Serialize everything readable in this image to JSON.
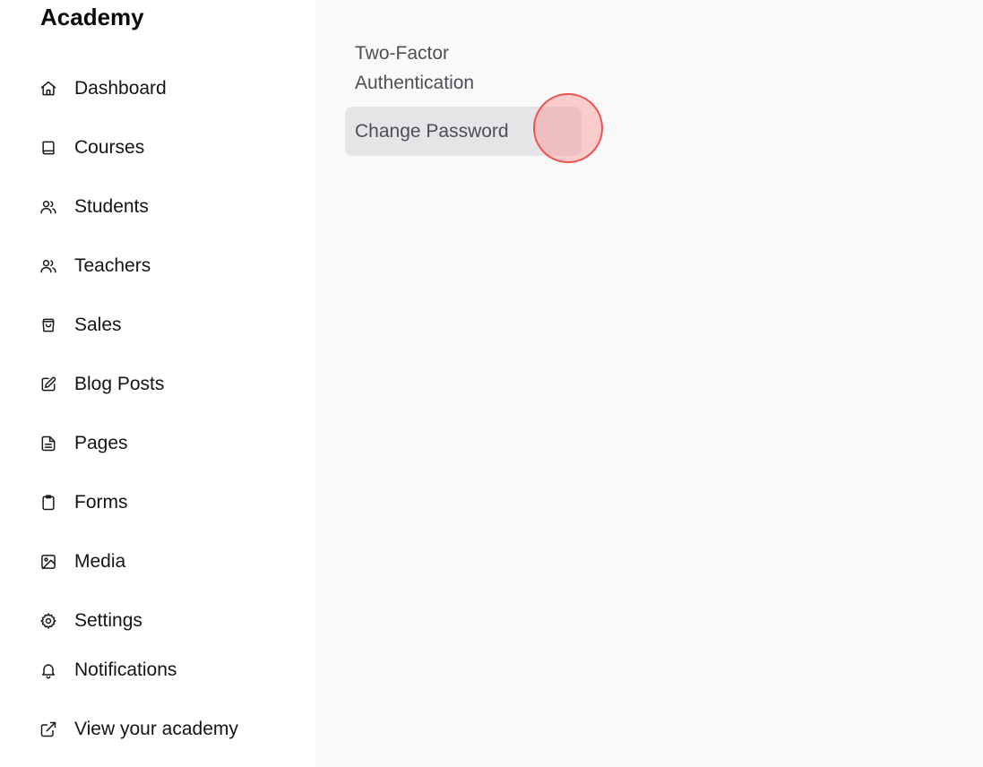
{
  "sidebar": {
    "brand": "Academy",
    "items": [
      {
        "label": "Dashboard",
        "icon": "home-icon"
      },
      {
        "label": "Courses",
        "icon": "book-icon"
      },
      {
        "label": "Students",
        "icon": "users-icon"
      },
      {
        "label": "Teachers",
        "icon": "users-icon"
      },
      {
        "label": "Sales",
        "icon": "shopping-bag-icon"
      },
      {
        "label": "Blog Posts",
        "icon": "edit-icon"
      },
      {
        "label": "Pages",
        "icon": "file-text-icon"
      },
      {
        "label": "Forms",
        "icon": "clipboard-icon"
      },
      {
        "label": "Media",
        "icon": "image-icon"
      },
      {
        "label": "Settings",
        "icon": "gear-icon"
      },
      {
        "label": "Notifications",
        "icon": "bell-icon"
      },
      {
        "label": "View your academy",
        "icon": "external-link-icon"
      }
    ]
  },
  "main": {
    "submenu": [
      {
        "label": "Two-Factor Authentication",
        "active": false
      },
      {
        "label": "Change Password",
        "active": true
      }
    ]
  },
  "colors": {
    "sidebar_bg": "#ffffff",
    "main_bg": "#f9f9f9",
    "active_bg": "#e5e5e8",
    "click_marker": "#ef5050"
  }
}
